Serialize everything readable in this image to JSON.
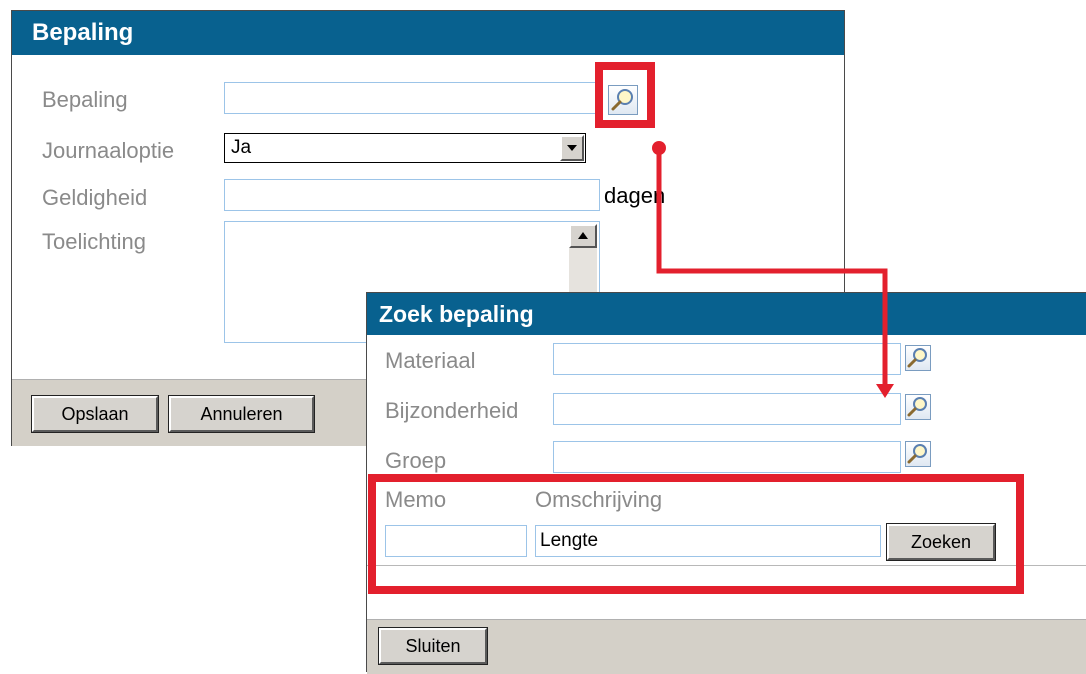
{
  "bepaling_dialog": {
    "title": "Bepaling",
    "fields": {
      "bepaling_label": "Bepaling",
      "journaaloptie_label": "Journaaloptie",
      "journaaloptie_value": "Ja",
      "geldigheid_label": "Geldigheid",
      "geldigheid_unit": "dagen",
      "toelichting_label": "Toelichting"
    },
    "buttons": {
      "save": "Opslaan",
      "cancel": "Annuleren"
    }
  },
  "zoek_dialog": {
    "title": "Zoek bepaling",
    "fields": {
      "materiaal_label": "Materiaal",
      "bijzonderheid_label": "Bijzonderheid",
      "groep_label": "Groep",
      "memo_label": "Memo",
      "omschrijving_label": "Omschrijving",
      "omschrijving_value": "Lengte"
    },
    "buttons": {
      "search": "Zoeken",
      "close": "Sluiten"
    }
  },
  "colors": {
    "titlebar": "#08618f",
    "highlight": "#e3202d",
    "label_text": "#8a8a8a",
    "footer": "#d4d0c8",
    "field_border": "#9cc4e8"
  },
  "icons": {
    "lookup": "magnifier-icon",
    "dropdown": "triangle-down-icon",
    "scroll_up": "triangle-up-icon"
  }
}
